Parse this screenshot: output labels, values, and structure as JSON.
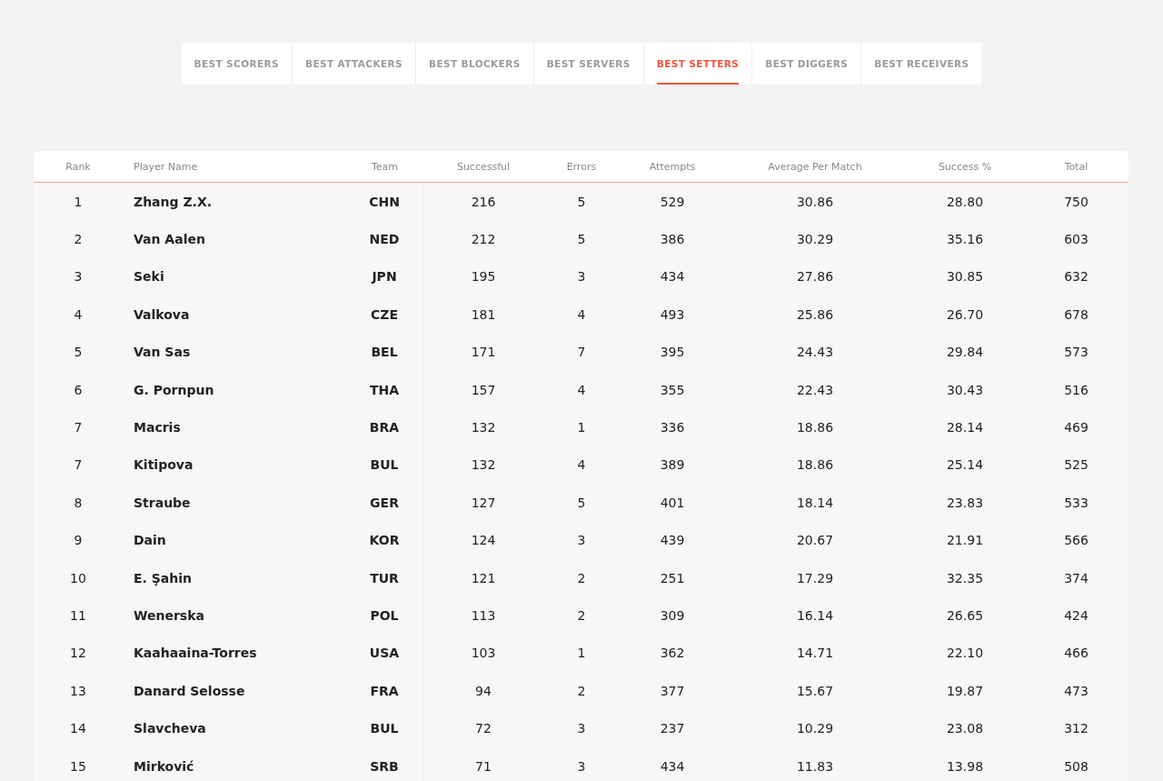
{
  "tabs": [
    {
      "label": "BEST SCORERS",
      "selected": false
    },
    {
      "label": "BEST ATTACKERS",
      "selected": false
    },
    {
      "label": "BEST BLOCKERS",
      "selected": false
    },
    {
      "label": "BEST SERVERS",
      "selected": false
    },
    {
      "label": "BEST SETTERS",
      "selected": true
    },
    {
      "label": "BEST DIGGERS",
      "selected": false
    },
    {
      "label": "BEST RECEIVERS",
      "selected": false
    }
  ],
  "table": {
    "columns": [
      "Rank",
      "Player Name",
      "Team",
      "Successful",
      "Errors",
      "Attempts",
      "Average Per Match",
      "Success %",
      "Total"
    ],
    "rows": [
      [
        "1",
        "Zhang Z.X.",
        "CHN",
        "216",
        "5",
        "529",
        "30.86",
        "28.80",
        "750"
      ],
      [
        "2",
        "Van Aalen",
        "NED",
        "212",
        "5",
        "386",
        "30.29",
        "35.16",
        "603"
      ],
      [
        "3",
        "Seki",
        "JPN",
        "195",
        "3",
        "434",
        "27.86",
        "30.85",
        "632"
      ],
      [
        "4",
        "Valkova",
        "CZE",
        "181",
        "4",
        "493",
        "25.86",
        "26.70",
        "678"
      ],
      [
        "5",
        "Van Sas",
        "BEL",
        "171",
        "7",
        "395",
        "24.43",
        "29.84",
        "573"
      ],
      [
        "6",
        "G. Pornpun",
        "THA",
        "157",
        "4",
        "355",
        "22.43",
        "30.43",
        "516"
      ],
      [
        "7",
        "Macris",
        "BRA",
        "132",
        "1",
        "336",
        "18.86",
        "28.14",
        "469"
      ],
      [
        "7",
        "Kitipova",
        "BUL",
        "132",
        "4",
        "389",
        "18.86",
        "25.14",
        "525"
      ],
      [
        "8",
        "Straube",
        "GER",
        "127",
        "5",
        "401",
        "18.14",
        "23.83",
        "533"
      ],
      [
        "9",
        "Dain",
        "KOR",
        "124",
        "3",
        "439",
        "20.67",
        "21.91",
        "566"
      ],
      [
        "10",
        "E. Şahin",
        "TUR",
        "121",
        "2",
        "251",
        "17.29",
        "32.35",
        "374"
      ],
      [
        "11",
        "Wenerska",
        "POL",
        "113",
        "2",
        "309",
        "16.14",
        "26.65",
        "424"
      ],
      [
        "12",
        "Kaahaaina-Torres",
        "USA",
        "103",
        "1",
        "362",
        "14.71",
        "22.10",
        "466"
      ],
      [
        "13",
        "Danard Selosse",
        "FRA",
        "94",
        "2",
        "377",
        "15.67",
        "19.87",
        "473"
      ],
      [
        "14",
        "Slavcheva",
        "BUL",
        "72",
        "3",
        "237",
        "10.29",
        "23.08",
        "312"
      ],
      [
        "15",
        "Mirković",
        "SRB",
        "71",
        "3",
        "434",
        "11.83",
        "13.98",
        "508"
      ]
    ]
  }
}
